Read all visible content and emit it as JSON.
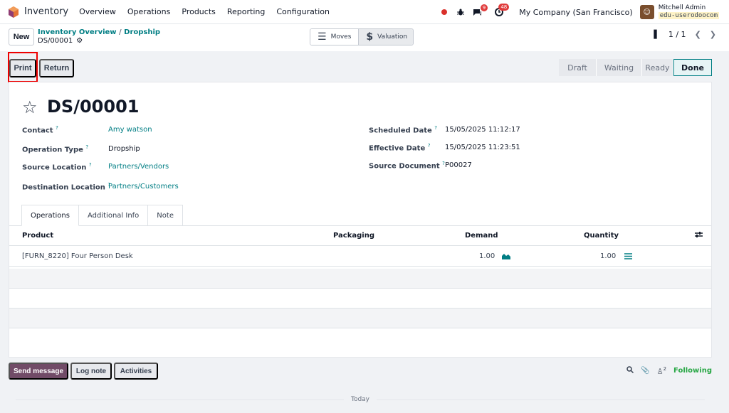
{
  "app": {
    "name": "Inventory"
  },
  "topnav": [
    "Overview",
    "Operations",
    "Products",
    "Reporting",
    "Configuration"
  ],
  "systray": {
    "chat_count": "9",
    "activity_count": "48",
    "company": "My Company (San Francisco)",
    "user": "Mitchell Admin",
    "db": "edu-userodoocom"
  },
  "actions": {
    "new": "New"
  },
  "breadcrumb": {
    "parent": "Inventory Overview",
    "separator": "/",
    "current": "Dropship",
    "record": "DS/00001"
  },
  "smart": {
    "moves": "Moves",
    "valuation": "Valuation"
  },
  "pager": {
    "value": "1 / 1"
  },
  "buttons": {
    "print": "Print",
    "return": "Return"
  },
  "status": {
    "draft": "Draft",
    "waiting": "Waiting",
    "ready": "Ready",
    "done": "Done"
  },
  "record": {
    "title": "DS/00001",
    "help": "?",
    "contact_label": "Contact",
    "contact": "Amy watson",
    "op_type_label": "Operation Type",
    "op_type": "Dropship",
    "src_label": "Source Location",
    "src": "Partners/Vendors",
    "dest_label": "Destination Location",
    "dest": "Partners/Customers",
    "sched_label": "Scheduled Date",
    "sched": "15/05/2025 11:12:17",
    "eff_label": "Effective Date",
    "eff": "15/05/2025 11:23:51",
    "srcdoc_label": "Source Document",
    "srcdoc": "P00027"
  },
  "tabs": [
    "Operations",
    "Additional Info",
    "Note"
  ],
  "table": {
    "headers": {
      "product": "Product",
      "packaging": "Packaging",
      "demand": "Demand",
      "quantity": "Quantity"
    },
    "row": {
      "product": "[FURN_8220] Four Person Desk",
      "demand": "1.00",
      "quantity": "1.00"
    }
  },
  "chatter": {
    "send": "Send message",
    "log": "Log note",
    "activities": "Activities",
    "followers": "2",
    "following": "Following",
    "today": "Today"
  }
}
